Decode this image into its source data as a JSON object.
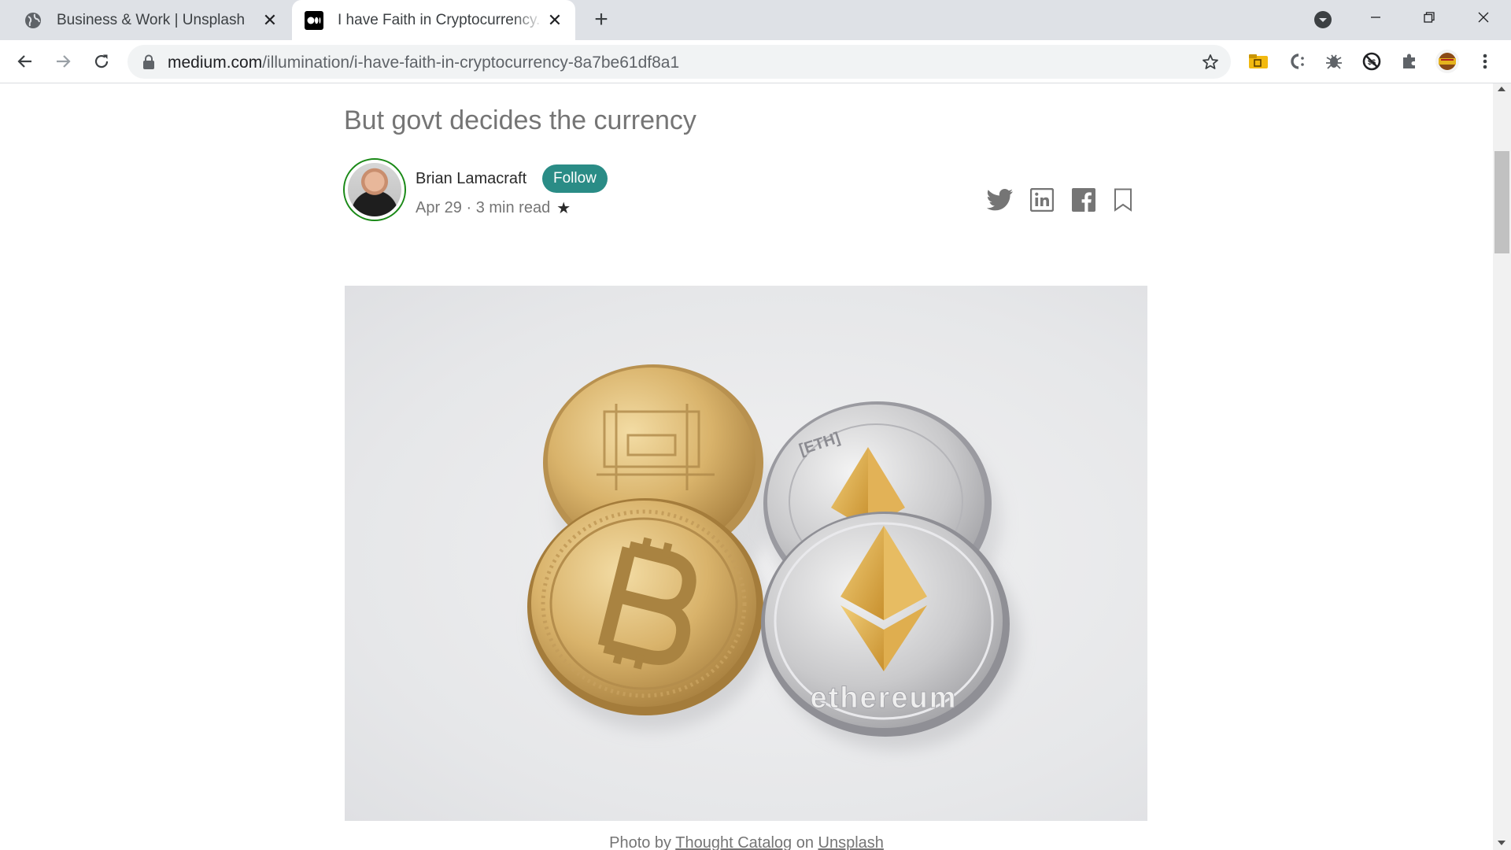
{
  "browser": {
    "tabs": [
      {
        "title": "Business & Work | Unsplash",
        "favicon": "globe-icon",
        "active": false
      },
      {
        "title": "I have Faith in Cryptocurrency. But govt decides the currency",
        "favicon": "medium-logo-icon",
        "active": true
      }
    ],
    "url": {
      "host": "medium.com",
      "path": "/illumination/i-have-faith-in-cryptocurrency-8a7be61df8a1"
    },
    "extensions": [
      "folder-extension-icon",
      "c-extension-icon",
      "bug-extension-icon",
      "blocked-extension-icon",
      "puzzle-extensions-icon",
      "profile-avatar-icon"
    ]
  },
  "article": {
    "subtitle": "But govt decides the currency",
    "author": {
      "name": "Brian Lamacraft",
      "follow_label": "Follow"
    },
    "meta": {
      "date_read": "Apr 29 · 3 min read",
      "member_star": "★"
    },
    "share_icons": [
      "twitter-icon",
      "linkedin-icon",
      "facebook-icon",
      "bookmark-icon"
    ],
    "image": {
      "coin_text": "ethereum",
      "eth_ring_text": "[ETH]",
      "caption_prefix": "Photo by ",
      "caption_author": "Thought Catalog",
      "caption_middle": " on ",
      "caption_source": "Unsplash"
    }
  },
  "colors": {
    "follow_button": "#2a8c86",
    "avatar_ring": "#1a8917",
    "text_primary": "#292929",
    "text_secondary": "#757575"
  }
}
